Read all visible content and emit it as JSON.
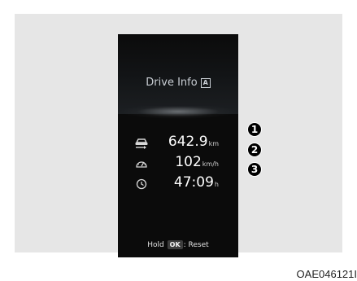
{
  "display": {
    "title": "Drive Info",
    "title_badge": "A",
    "rows": [
      {
        "icon": "car-distance-icon",
        "value": "642.9",
        "unit": "km",
        "callout": "1"
      },
      {
        "icon": "speedometer-icon",
        "value": "102",
        "unit": "km/h",
        "callout": "2"
      },
      {
        "icon": "clock-icon",
        "value": "47:09",
        "unit": "h",
        "callout": "3"
      }
    ],
    "hold_prefix": "Hold",
    "hold_key": "OK",
    "hold_suffix": ": Reset"
  },
  "caption": "OAE046121I",
  "colors": {
    "frame": "#e6e6e6",
    "display_bg": "#0b0b0b",
    "title_text": "#c9ced4",
    "value_text": "#ffffff"
  }
}
